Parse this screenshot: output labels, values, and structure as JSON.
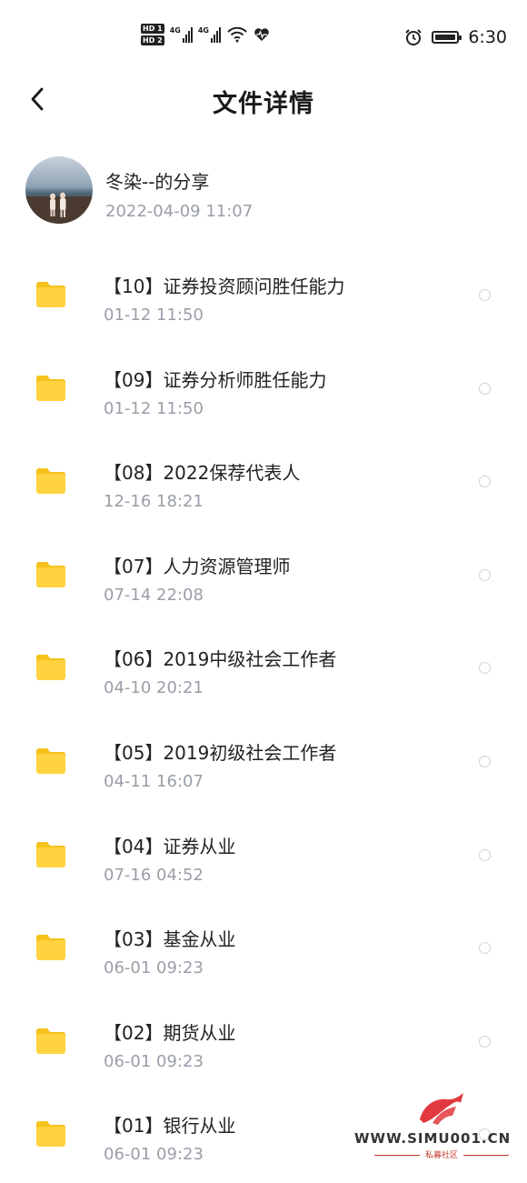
{
  "status_bar": {
    "hd1": "HD 1",
    "hd2": "HD 2",
    "net1": "4G",
    "net2": "4G",
    "time": "6:30",
    "icons": [
      "signal-icon",
      "wifi-icon",
      "heart-rate-icon",
      "alarm-icon",
      "battery-icon"
    ]
  },
  "header": {
    "title": "文件详情",
    "back_icon": "chevron-left-icon"
  },
  "sharer": {
    "name": "冬染--的分享",
    "time": "2022-04-09  11:07"
  },
  "files": [
    {
      "name": "【10】证券投资顾问胜任能力",
      "time": "01-12  11:50"
    },
    {
      "name": "【09】证券分析师胜任能力",
      "time": "01-12  11:50"
    },
    {
      "name": "【08】2022保荐代表人",
      "time": "12-16  18:21"
    },
    {
      "name": "【07】人力资源管理师",
      "time": "07-14  22:08"
    },
    {
      "name": "【06】2019中级社会工作者",
      "time": "04-10  20:21"
    },
    {
      "name": "【05】2019初级社会工作者",
      "time": "04-11  16:07"
    },
    {
      "name": "【04】证券从业",
      "time": "07-16  04:52"
    },
    {
      "name": "【03】基金从业",
      "time": "06-01  09:23"
    },
    {
      "name": "【02】期货从业",
      "time": "06-01  09:23"
    },
    {
      "name": "【01】银行从业",
      "time": "06-01  09:23"
    }
  ],
  "colors": {
    "folder": "#FFD23F",
    "folder_tab": "#F5C21B",
    "secondary_text": "#9A9EA8",
    "radio_border": "#CFD2D8",
    "watermark_red": "#E0393E"
  },
  "watermark": {
    "url": "WWW.SIMU001.CN",
    "sub": "私募社区"
  }
}
